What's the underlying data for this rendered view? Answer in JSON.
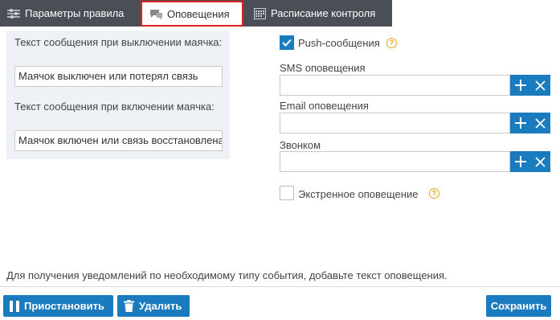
{
  "tabs": [
    {
      "label": "Параметры правила",
      "icon": "sliders-icon",
      "active": false
    },
    {
      "label": "Оповещения",
      "icon": "notification-icon",
      "active": true
    },
    {
      "label": "Расписание контроля",
      "icon": "calendar-icon",
      "active": false
    }
  ],
  "left": {
    "off_label": "Текст сообщения при выключении маячка:",
    "off_value": "Маячок выключен или потерял связь",
    "on_label": "Текст сообщения при включении маячка:",
    "on_value": "Маячок включен или связь восстановлена"
  },
  "right": {
    "push_label": "Push-сообщения",
    "push_checked": true,
    "sms_label": "SMS оповещения",
    "sms_value": "",
    "email_label": "Email оповещения",
    "email_value": "",
    "call_label": "Звонком",
    "call_value": "",
    "emergency_label": "Экстренное оповещение",
    "emergency_checked": false
  },
  "hint": "Для получения уведомлений по необходимому типу события, добавьте текст оповещения.",
  "footer": {
    "pause_label": "Приостановить",
    "delete_label": "Удалить",
    "save_label": "Сохранить"
  },
  "colors": {
    "accent": "#1a7bbf",
    "tabbar": "#4a4e56",
    "highlight": "#e02020",
    "help": "#e8a317"
  }
}
